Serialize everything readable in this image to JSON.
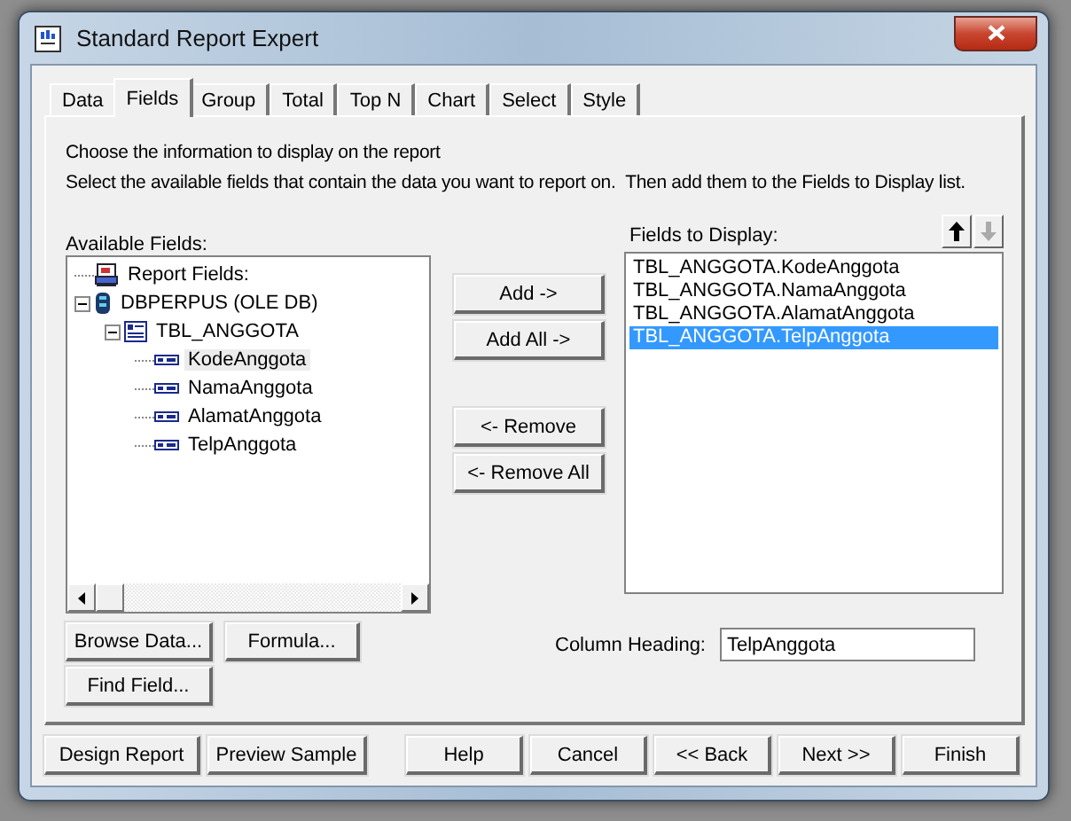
{
  "window": {
    "title": "Standard Report Expert"
  },
  "tabs": [
    {
      "label": "Data",
      "selected": false
    },
    {
      "label": "Fields",
      "selected": true
    },
    {
      "label": "Group",
      "selected": false
    },
    {
      "label": "Total",
      "selected": false
    },
    {
      "label": "Top N",
      "selected": false
    },
    {
      "label": "Chart",
      "selected": false
    },
    {
      "label": "Select",
      "selected": false
    },
    {
      "label": "Style",
      "selected": false
    }
  ],
  "instructions": [
    "Choose the information to display on the report",
    "Select the available fields that contain the data you want to report on.  Then add them to the Fields to Display list."
  ],
  "available_fields": {
    "label": "Available Fields:",
    "tree": [
      {
        "label": "Report Fields:",
        "kind": "report",
        "selected": false
      },
      {
        "label": "DBPERPUS (OLE DB)",
        "kind": "database",
        "expanded": true,
        "selected": false,
        "children": [
          {
            "label": "TBL_ANGGOTA",
            "kind": "table",
            "expanded": true,
            "selected": false,
            "children": [
              {
                "label": "KodeAnggota",
                "kind": "field",
                "selected": true
              },
              {
                "label": "NamaAnggota",
                "kind": "field",
                "selected": false
              },
              {
                "label": "AlamatAnggota",
                "kind": "field",
                "selected": false
              },
              {
                "label": "TelpAnggota",
                "kind": "field",
                "selected": false
              }
            ]
          }
        ]
      }
    ]
  },
  "left_buttons": [
    "Browse Data...",
    "Formula...",
    "Find Field..."
  ],
  "middle_buttons": [
    "Add ->",
    "Add All ->",
    "<- Remove",
    "<- Remove All"
  ],
  "fields_to_display": {
    "label": "Fields to Display:",
    "move_up": {
      "disabled": false
    },
    "move_down": {
      "disabled": true
    },
    "items": [
      {
        "label": "TBL_ANGGOTA.KodeAnggota",
        "selected": false
      },
      {
        "label": "TBL_ANGGOTA.NamaAnggota",
        "selected": false
      },
      {
        "label": "TBL_ANGGOTA.AlamatAnggota",
        "selected": false
      },
      {
        "label": "TBL_ANGGOTA.TelpAnggota",
        "selected": true
      }
    ]
  },
  "column_heading": {
    "label": "Column Heading:",
    "value": "TelpAnggota"
  },
  "bottom_buttons": [
    "Design Report",
    "Preview Sample",
    "Help",
    "Cancel",
    "<< Back",
    "Next >>",
    "Finish"
  ]
}
